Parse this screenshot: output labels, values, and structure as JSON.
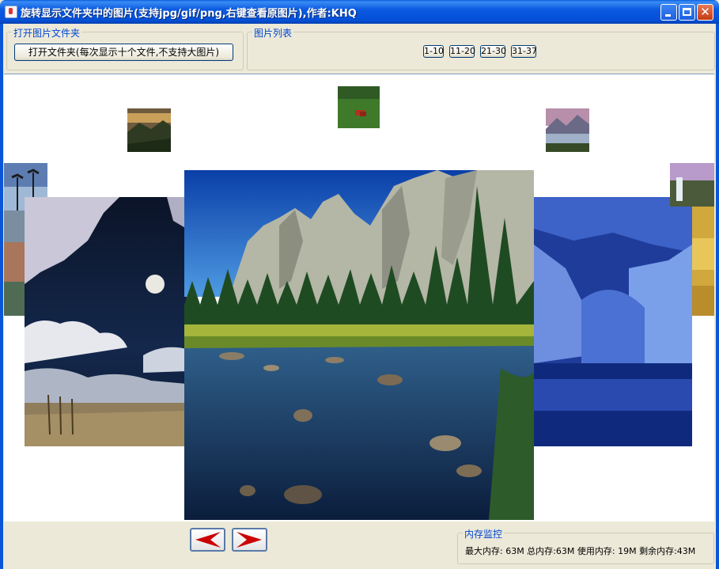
{
  "window": {
    "title": "旋转显示文件夹中的图片(支持jpg/gif/png,右键查看原图片),作者:KHQ",
    "minimize_label": "",
    "maximize_label": "",
    "close_label": "✕"
  },
  "open_panel": {
    "title": "打开图片文件夹",
    "open_button_label": "打开文件夹(每次显示十个文件,不支持大图片)"
  },
  "list_panel": {
    "title": "图片列表",
    "pages": [
      "1-10",
      "11-20",
      "21-30",
      "31-37"
    ]
  },
  "gallery": {
    "photos": [
      {
        "name": "sunset-valley"
      },
      {
        "name": "meadow-animals"
      },
      {
        "name": "lake-mountains"
      },
      {
        "name": "palm-sunset"
      },
      {
        "name": "autumn-forest"
      },
      {
        "name": "moonlit-night"
      },
      {
        "name": "yosemite-valley"
      },
      {
        "name": "blue-winter-lake"
      },
      {
        "name": "waterfall-cliff"
      },
      {
        "name": "golden-trees"
      }
    ]
  },
  "navigation": {
    "prev": "previous-arrow-icon",
    "next": "next-arrow-icon"
  },
  "memory_panel": {
    "title": "内存监控",
    "status": "最大内存: 63M 总内存:63M 使用内存: 19M 剩余内存:43M"
  },
  "colors": {
    "titlebar": "#0b5ae0",
    "group_title": "#0046d5",
    "arrow_red": "#cc0000"
  }
}
